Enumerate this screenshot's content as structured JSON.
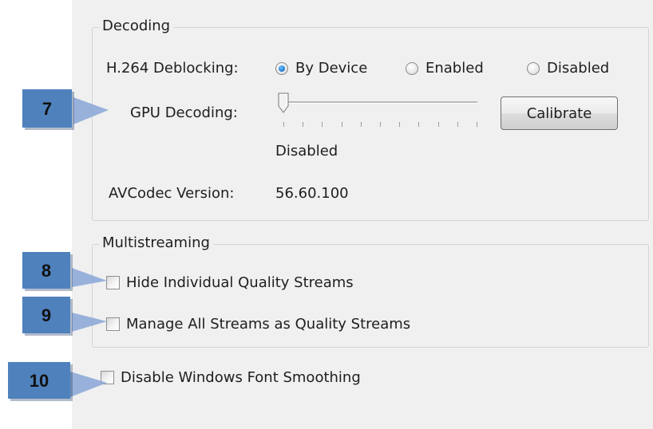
{
  "decoding": {
    "legend": "Decoding",
    "deblocking_label": "H.264 Deblocking:",
    "deblocking_options": [
      {
        "label": "By Device",
        "selected": true
      },
      {
        "label": "Enabled",
        "selected": false
      },
      {
        "label": "Disabled",
        "selected": false
      }
    ],
    "gpu_label": "GPU Decoding:",
    "gpu_slider_value": 0,
    "gpu_slider_tick_count": 11,
    "gpu_value_text": "Disabled",
    "calibrate_label": "Calibrate",
    "avcodec_label": "AVCodec Version:",
    "avcodec_value": "56.60.100"
  },
  "multistreaming": {
    "legend": "Multistreaming",
    "hide_label": "Hide Individual Quality Streams",
    "hide_checked": false,
    "manage_label": "Manage All Streams as Quality Streams",
    "manage_checked": false
  },
  "font_smoothing": {
    "label": "Disable Windows Font Smoothing",
    "checked": false
  },
  "callouts": {
    "c7": "7",
    "c8": "8",
    "c9": "9",
    "c10": "10"
  },
  "colors": {
    "marker_fill": "#4f81bd",
    "panel_bg": "#f0f0f0",
    "radio_selected": "#1f77d0"
  }
}
